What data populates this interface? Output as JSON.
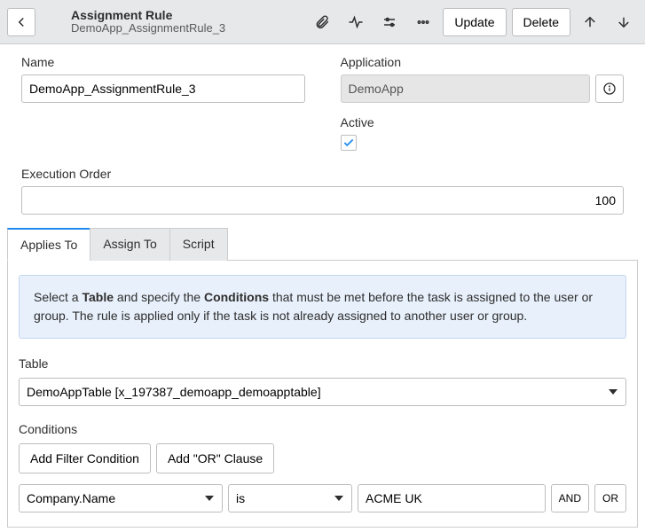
{
  "header": {
    "record_type": "Assignment Rule",
    "record_name": "DemoApp_AssignmentRule_3",
    "update_label": "Update",
    "delete_label": "Delete"
  },
  "form": {
    "name_label": "Name",
    "name_value": "DemoApp_AssignmentRule_3",
    "app_label": "Application",
    "app_value": "DemoApp",
    "active_label": "Active",
    "active_checked": true,
    "exec_order_label": "Execution Order",
    "exec_order_value": "100"
  },
  "tabs": {
    "t0": "Applies To",
    "t1": "Assign To",
    "t2": "Script"
  },
  "applies_to": {
    "notice_pre": "Select a ",
    "notice_b1": "Table",
    "notice_mid": " and specify the ",
    "notice_b2": "Conditions",
    "notice_post": " that must be met before the task is assigned to the user or group. The rule is applied only if the task is not already assigned to another user or group.",
    "table_label": "Table",
    "table_value": "DemoAppTable [x_197387_demoapp_demoapptable]",
    "conditions_label": "Conditions",
    "add_filter_label": "Add Filter Condition",
    "add_or_label": "Add \"OR\" Clause",
    "cond_field": "Company.Name",
    "cond_op": "is",
    "cond_value": "ACME UK",
    "and_label": "AND",
    "or_label": "OR"
  }
}
